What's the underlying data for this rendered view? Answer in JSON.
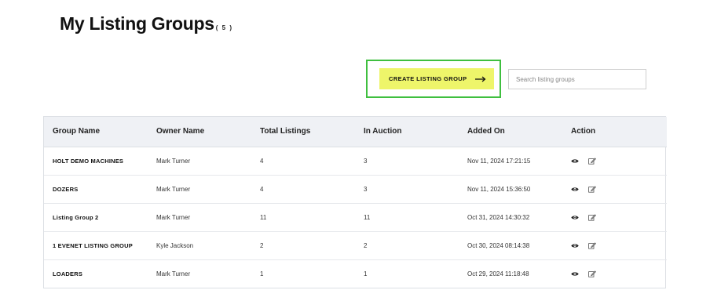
{
  "header": {
    "title": "My Listing Groups",
    "count": "( 5 )"
  },
  "toolbar": {
    "create_label": "CREATE LISTING GROUP",
    "create_icon": "arrow-right-icon",
    "search_placeholder": "Search listing groups",
    "search_value": ""
  },
  "colors": {
    "create_button_bg": "#eef56a",
    "highlight_border": "#3fbf3f",
    "table_header_bg": "#eff1f5"
  },
  "table": {
    "columns": [
      "Group Name",
      "Owner Name",
      "Total Listings",
      "In Auction",
      "Added On",
      "Action"
    ],
    "rows": [
      {
        "group_name": "HOLT DEMO MACHINES",
        "owner": "Mark Turner",
        "total": "4",
        "in_auction": "3",
        "added_on": "Nov 11, 2024 17:21:15"
      },
      {
        "group_name": "DOZERS",
        "owner": "Mark Turner",
        "total": "4",
        "in_auction": "3",
        "added_on": "Nov 11, 2024 15:36:50"
      },
      {
        "group_name": "Listing Group 2",
        "owner": "Mark Turner",
        "total": "11",
        "in_auction": "11",
        "added_on": "Oct 31, 2024 14:30:32"
      },
      {
        "group_name": "1 EVENET LISTING GROUP",
        "owner": "Kyle Jackson",
        "total": "2",
        "in_auction": "2",
        "added_on": "Oct 30, 2024 08:14:38"
      },
      {
        "group_name": "LOADERS",
        "owner": "Mark Turner",
        "total": "1",
        "in_auction": "1",
        "added_on": "Oct 29, 2024 11:18:48"
      }
    ],
    "action_icons": [
      "eye-icon",
      "edit-icon"
    ]
  }
}
